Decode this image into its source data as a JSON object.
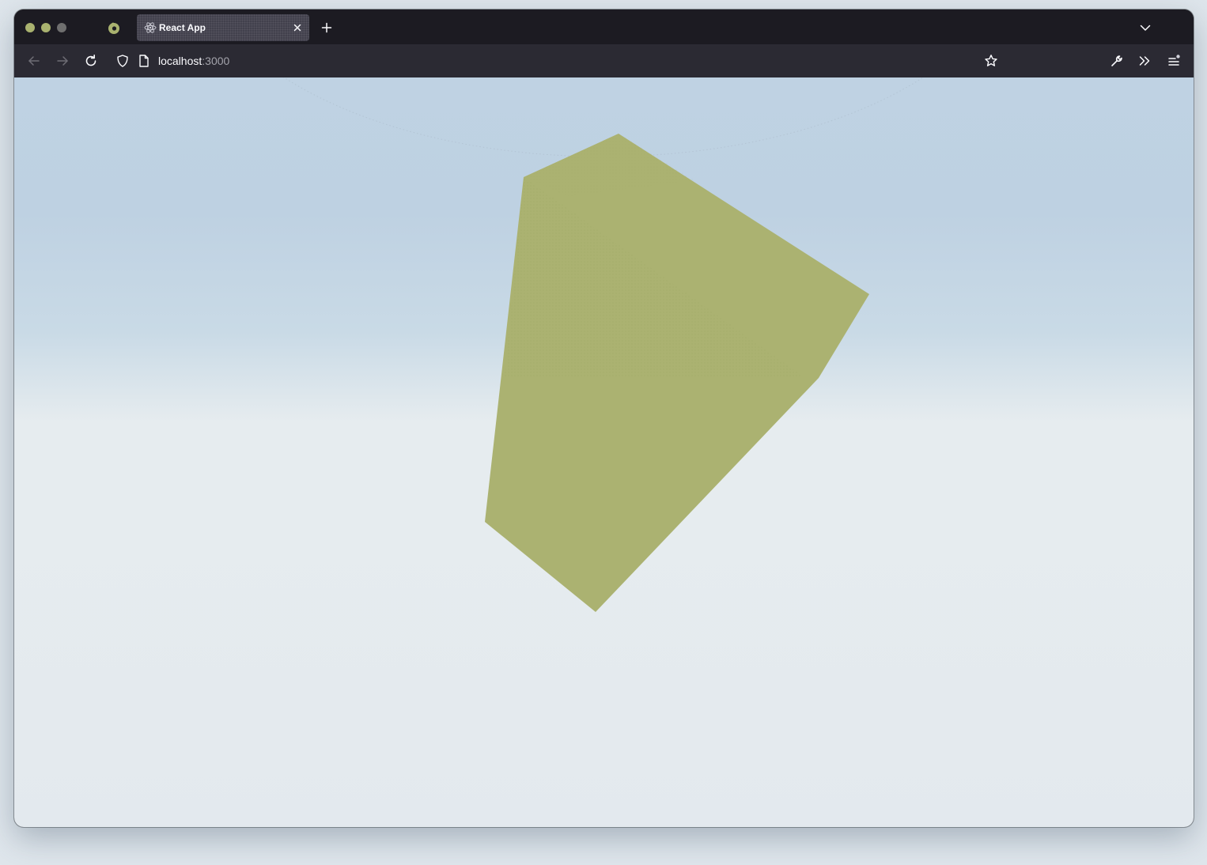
{
  "browser": {
    "tab": {
      "title": "React App"
    },
    "url": {
      "host": "localhost",
      "port": ":3000"
    }
  },
  "scene": {
    "shape_color": "#abb271",
    "sky_color": "#bfd2e3",
    "ground_color": "#e6ecef"
  },
  "icons": {
    "pinned_tab": "firefox-icon",
    "tab_favicon": "react-icon",
    "back": "arrow-left-icon",
    "forward": "arrow-right-icon",
    "reload": "reload-icon",
    "shield": "shield-icon",
    "page": "page-icon",
    "bookmark": "star-icon",
    "devtools": "wrench-icon",
    "overflow": "double-chevron-icon",
    "menu": "hamburger-icon"
  }
}
